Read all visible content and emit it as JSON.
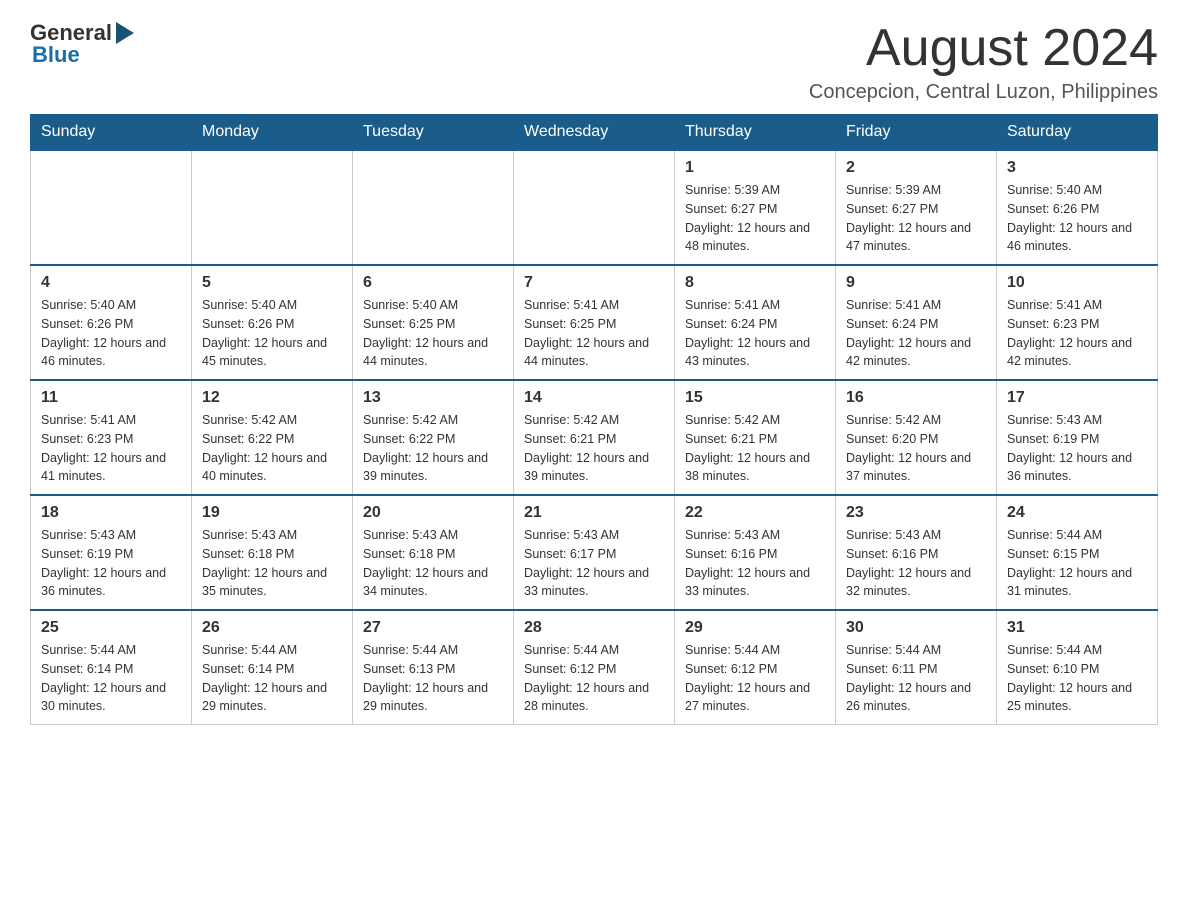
{
  "header": {
    "logo": {
      "text_general": "General",
      "text_blue": "Blue"
    },
    "title": "August 2024",
    "location": "Concepcion, Central Luzon, Philippines"
  },
  "days_of_week": [
    "Sunday",
    "Monday",
    "Tuesday",
    "Wednesday",
    "Thursday",
    "Friday",
    "Saturday"
  ],
  "weeks": [
    {
      "days": [
        {
          "number": "",
          "sunrise": "",
          "sunset": "",
          "daylight": ""
        },
        {
          "number": "",
          "sunrise": "",
          "sunset": "",
          "daylight": ""
        },
        {
          "number": "",
          "sunrise": "",
          "sunset": "",
          "daylight": ""
        },
        {
          "number": "",
          "sunrise": "",
          "sunset": "",
          "daylight": ""
        },
        {
          "number": "1",
          "sunrise": "Sunrise: 5:39 AM",
          "sunset": "Sunset: 6:27 PM",
          "daylight": "Daylight: 12 hours and 48 minutes."
        },
        {
          "number": "2",
          "sunrise": "Sunrise: 5:39 AM",
          "sunset": "Sunset: 6:27 PM",
          "daylight": "Daylight: 12 hours and 47 minutes."
        },
        {
          "number": "3",
          "sunrise": "Sunrise: 5:40 AM",
          "sunset": "Sunset: 6:26 PM",
          "daylight": "Daylight: 12 hours and 46 minutes."
        }
      ]
    },
    {
      "days": [
        {
          "number": "4",
          "sunrise": "Sunrise: 5:40 AM",
          "sunset": "Sunset: 6:26 PM",
          "daylight": "Daylight: 12 hours and 46 minutes."
        },
        {
          "number": "5",
          "sunrise": "Sunrise: 5:40 AM",
          "sunset": "Sunset: 6:26 PM",
          "daylight": "Daylight: 12 hours and 45 minutes."
        },
        {
          "number": "6",
          "sunrise": "Sunrise: 5:40 AM",
          "sunset": "Sunset: 6:25 PM",
          "daylight": "Daylight: 12 hours and 44 minutes."
        },
        {
          "number": "7",
          "sunrise": "Sunrise: 5:41 AM",
          "sunset": "Sunset: 6:25 PM",
          "daylight": "Daylight: 12 hours and 44 minutes."
        },
        {
          "number": "8",
          "sunrise": "Sunrise: 5:41 AM",
          "sunset": "Sunset: 6:24 PM",
          "daylight": "Daylight: 12 hours and 43 minutes."
        },
        {
          "number": "9",
          "sunrise": "Sunrise: 5:41 AM",
          "sunset": "Sunset: 6:24 PM",
          "daylight": "Daylight: 12 hours and 42 minutes."
        },
        {
          "number": "10",
          "sunrise": "Sunrise: 5:41 AM",
          "sunset": "Sunset: 6:23 PM",
          "daylight": "Daylight: 12 hours and 42 minutes."
        }
      ]
    },
    {
      "days": [
        {
          "number": "11",
          "sunrise": "Sunrise: 5:41 AM",
          "sunset": "Sunset: 6:23 PM",
          "daylight": "Daylight: 12 hours and 41 minutes."
        },
        {
          "number": "12",
          "sunrise": "Sunrise: 5:42 AM",
          "sunset": "Sunset: 6:22 PM",
          "daylight": "Daylight: 12 hours and 40 minutes."
        },
        {
          "number": "13",
          "sunrise": "Sunrise: 5:42 AM",
          "sunset": "Sunset: 6:22 PM",
          "daylight": "Daylight: 12 hours and 39 minutes."
        },
        {
          "number": "14",
          "sunrise": "Sunrise: 5:42 AM",
          "sunset": "Sunset: 6:21 PM",
          "daylight": "Daylight: 12 hours and 39 minutes."
        },
        {
          "number": "15",
          "sunrise": "Sunrise: 5:42 AM",
          "sunset": "Sunset: 6:21 PM",
          "daylight": "Daylight: 12 hours and 38 minutes."
        },
        {
          "number": "16",
          "sunrise": "Sunrise: 5:42 AM",
          "sunset": "Sunset: 6:20 PM",
          "daylight": "Daylight: 12 hours and 37 minutes."
        },
        {
          "number": "17",
          "sunrise": "Sunrise: 5:43 AM",
          "sunset": "Sunset: 6:19 PM",
          "daylight": "Daylight: 12 hours and 36 minutes."
        }
      ]
    },
    {
      "days": [
        {
          "number": "18",
          "sunrise": "Sunrise: 5:43 AM",
          "sunset": "Sunset: 6:19 PM",
          "daylight": "Daylight: 12 hours and 36 minutes."
        },
        {
          "number": "19",
          "sunrise": "Sunrise: 5:43 AM",
          "sunset": "Sunset: 6:18 PM",
          "daylight": "Daylight: 12 hours and 35 minutes."
        },
        {
          "number": "20",
          "sunrise": "Sunrise: 5:43 AM",
          "sunset": "Sunset: 6:18 PM",
          "daylight": "Daylight: 12 hours and 34 minutes."
        },
        {
          "number": "21",
          "sunrise": "Sunrise: 5:43 AM",
          "sunset": "Sunset: 6:17 PM",
          "daylight": "Daylight: 12 hours and 33 minutes."
        },
        {
          "number": "22",
          "sunrise": "Sunrise: 5:43 AM",
          "sunset": "Sunset: 6:16 PM",
          "daylight": "Daylight: 12 hours and 33 minutes."
        },
        {
          "number": "23",
          "sunrise": "Sunrise: 5:43 AM",
          "sunset": "Sunset: 6:16 PM",
          "daylight": "Daylight: 12 hours and 32 minutes."
        },
        {
          "number": "24",
          "sunrise": "Sunrise: 5:44 AM",
          "sunset": "Sunset: 6:15 PM",
          "daylight": "Daylight: 12 hours and 31 minutes."
        }
      ]
    },
    {
      "days": [
        {
          "number": "25",
          "sunrise": "Sunrise: 5:44 AM",
          "sunset": "Sunset: 6:14 PM",
          "daylight": "Daylight: 12 hours and 30 minutes."
        },
        {
          "number": "26",
          "sunrise": "Sunrise: 5:44 AM",
          "sunset": "Sunset: 6:14 PM",
          "daylight": "Daylight: 12 hours and 29 minutes."
        },
        {
          "number": "27",
          "sunrise": "Sunrise: 5:44 AM",
          "sunset": "Sunset: 6:13 PM",
          "daylight": "Daylight: 12 hours and 29 minutes."
        },
        {
          "number": "28",
          "sunrise": "Sunrise: 5:44 AM",
          "sunset": "Sunset: 6:12 PM",
          "daylight": "Daylight: 12 hours and 28 minutes."
        },
        {
          "number": "29",
          "sunrise": "Sunrise: 5:44 AM",
          "sunset": "Sunset: 6:12 PM",
          "daylight": "Daylight: 12 hours and 27 minutes."
        },
        {
          "number": "30",
          "sunrise": "Sunrise: 5:44 AM",
          "sunset": "Sunset: 6:11 PM",
          "daylight": "Daylight: 12 hours and 26 minutes."
        },
        {
          "number": "31",
          "sunrise": "Sunrise: 5:44 AM",
          "sunset": "Sunset: 6:10 PM",
          "daylight": "Daylight: 12 hours and 25 minutes."
        }
      ]
    }
  ]
}
